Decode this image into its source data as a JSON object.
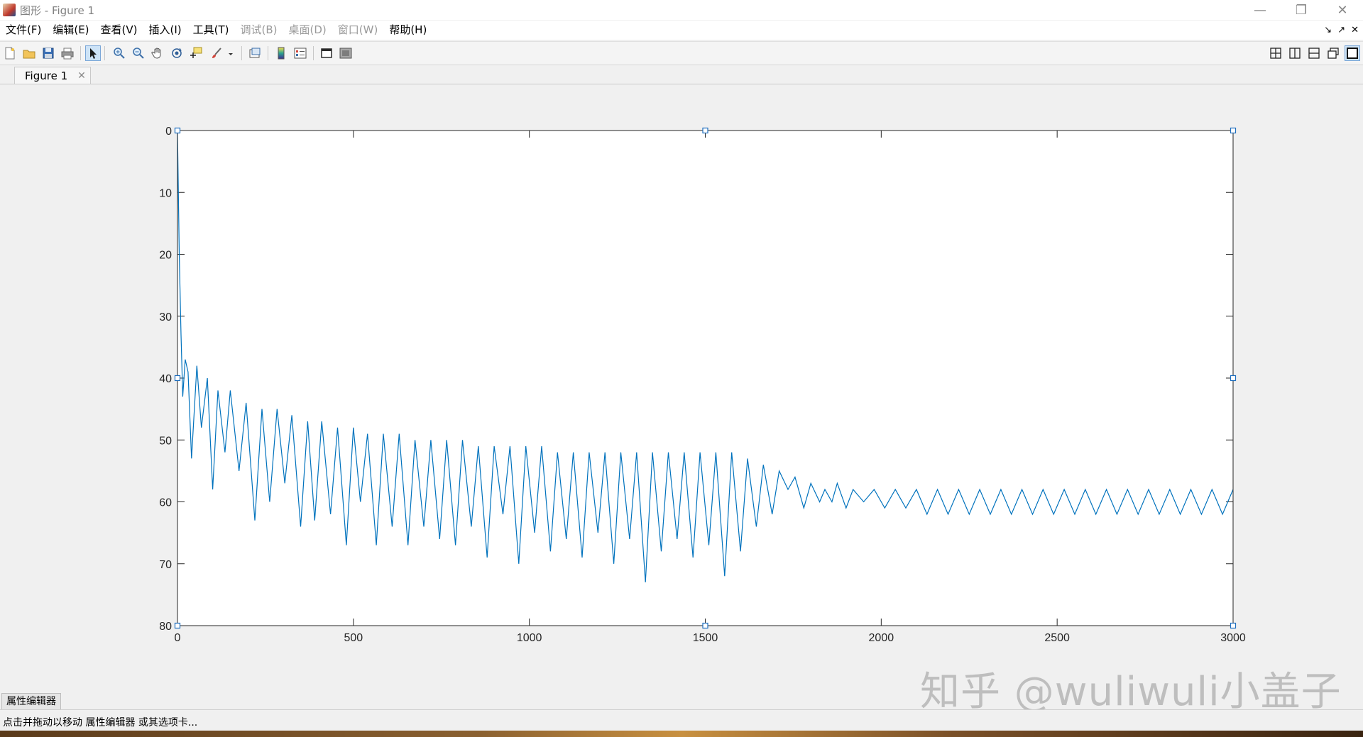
{
  "window": {
    "title": "图形 - Figure 1",
    "controls": {
      "minimize": "—",
      "restore": "❐",
      "close": "✕"
    }
  },
  "menu": {
    "items": [
      {
        "label": "文件(F)",
        "enabled": true
      },
      {
        "label": "编辑(E)",
        "enabled": true
      },
      {
        "label": "查看(V)",
        "enabled": true
      },
      {
        "label": "插入(I)",
        "enabled": true
      },
      {
        "label": "工具(T)",
        "enabled": true
      },
      {
        "label": "调试(B)",
        "enabled": false
      },
      {
        "label": "桌面(D)",
        "enabled": false
      },
      {
        "label": "窗口(W)",
        "enabled": false
      },
      {
        "label": "帮助(H)",
        "enabled": true
      }
    ],
    "right_icons": {
      "dock": "↘",
      "undock": "↗",
      "close": "✕"
    }
  },
  "tab": {
    "label": "Figure 1",
    "close": "✕"
  },
  "property_editor": {
    "label": "属性编辑器"
  },
  "status": {
    "text": "点击并拖动以移动 属性编辑器 或其选项卡..."
  },
  "watermark": {
    "text": "知乎 @wuliwuli小盖子"
  },
  "colors": {
    "line": "#0072BD",
    "axes": "#262626",
    "selection": "#1f6fbf"
  },
  "chart_data": {
    "type": "line",
    "title": "",
    "xlabel": "",
    "ylabel": "",
    "xlim": [
      0,
      3000
    ],
    "ylim": [
      0,
      80
    ],
    "y_direction": "reversed",
    "grid": false,
    "xticks": [
      0,
      500,
      1000,
      1500,
      2000,
      2500,
      3000
    ],
    "yticks": [
      0,
      10,
      20,
      30,
      40,
      50,
      60,
      70,
      80
    ],
    "series": [
      {
        "x": [
          0,
          5,
          10,
          15,
          22,
          30,
          40,
          55,
          68,
          85,
          100,
          115,
          135,
          150,
          175,
          195,
          220,
          240,
          262,
          283,
          305,
          325,
          350,
          370,
          390,
          410,
          435,
          455,
          480,
          500,
          520,
          540,
          565,
          585,
          610,
          630,
          655,
          675,
          700,
          720,
          745,
          765,
          790,
          810,
          835,
          855,
          880,
          900,
          925,
          945,
          970,
          990,
          1015,
          1035,
          1060,
          1080,
          1105,
          1125,
          1150,
          1170,
          1195,
          1215,
          1240,
          1260,
          1285,
          1305,
          1330,
          1350,
          1375,
          1395,
          1420,
          1440,
          1465,
          1485,
          1510,
          1530,
          1555,
          1575,
          1600,
          1620,
          1645,
          1665,
          1690,
          1710,
          1735,
          1755,
          1780,
          1800,
          1825,
          1840,
          1860,
          1875,
          1900,
          1920,
          1950,
          1980,
          2010,
          2040,
          2070,
          2100,
          2130,
          2160,
          2190,
          2220,
          2250,
          2280,
          2310,
          2340,
          2370,
          2400,
          2430,
          2460,
          2490,
          2520,
          2550,
          2580,
          2610,
          2640,
          2670,
          2700,
          2730,
          2760,
          2790,
          2820,
          2850,
          2880,
          2910,
          2940,
          2970,
          3000
        ],
        "y": [
          0,
          20,
          33,
          43,
          37,
          39,
          53,
          38,
          48,
          40,
          58,
          42,
          52,
          42,
          55,
          44,
          63,
          45,
          60,
          45,
          57,
          46,
          64,
          47,
          63,
          47,
          62,
          48,
          67,
          48,
          60,
          49,
          67,
          49,
          64,
          49,
          67,
          50,
          64,
          50,
          66,
          50,
          67,
          50,
          64,
          51,
          69,
          51,
          62,
          51,
          70,
          51,
          65,
          51,
          68,
          52,
          66,
          52,
          69,
          52,
          65,
          52,
          70,
          52,
          66,
          52,
          73,
          52,
          68,
          52,
          66,
          52,
          69,
          52,
          67,
          52,
          72,
          52,
          68,
          53,
          64,
          54,
          62,
          55,
          58,
          56,
          61,
          57,
          60,
          58,
          60,
          57,
          61,
          58,
          60,
          58,
          61,
          58,
          61,
          58,
          62,
          58,
          62,
          58,
          62,
          58,
          62,
          58,
          62,
          58,
          62,
          58,
          62,
          58,
          62,
          58,
          62,
          58,
          62,
          58,
          62,
          58,
          62,
          58,
          62,
          58,
          62,
          58,
          62,
          58
        ]
      }
    ]
  }
}
